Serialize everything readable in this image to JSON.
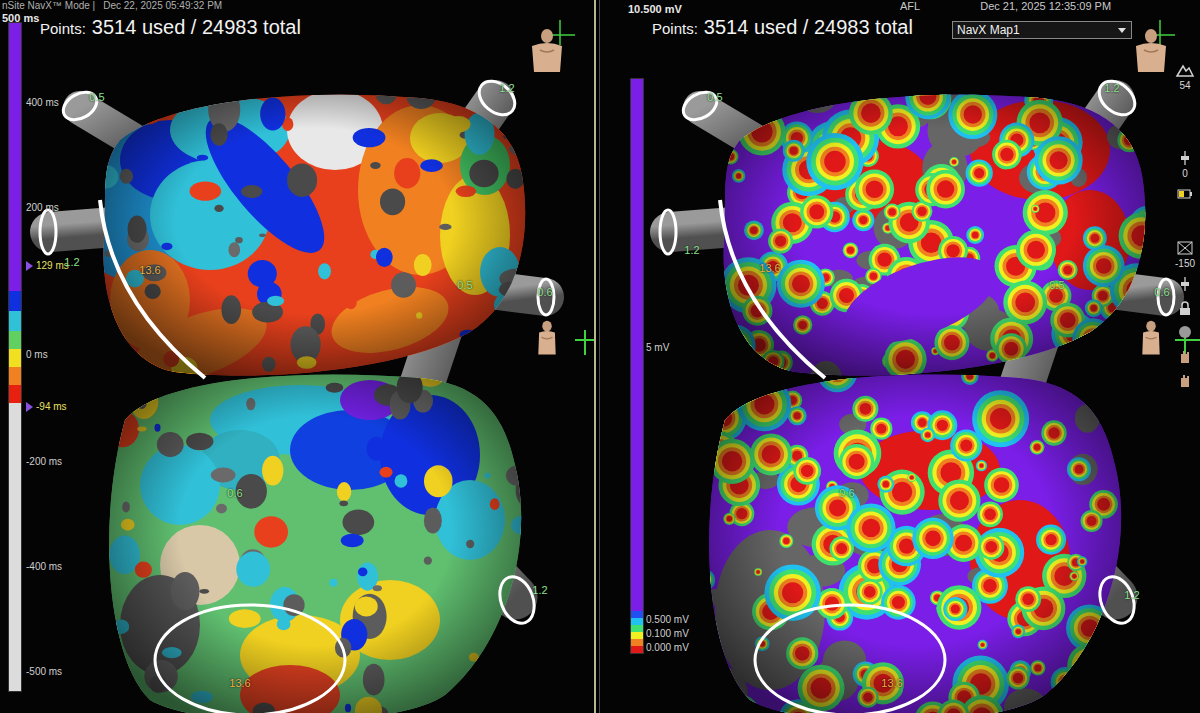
{
  "left_pane": {
    "header": {
      "mode": "nSite NavX™ Mode |",
      "date": "Dec 22, 2025 05:49:32 PM"
    },
    "points": {
      "label": "Points:",
      "value": "3514 used / 24983 total"
    },
    "scale": {
      "max": "500 ms",
      "ticks": [
        {
          "text": "400 ms",
          "kind": "tick"
        },
        {
          "text": "200 ms",
          "kind": "tick"
        },
        {
          "text": "129 ms",
          "kind": "marker"
        },
        {
          "text": "0 ms",
          "kind": "tick"
        },
        {
          "text": "-94 ms",
          "kind": "marker"
        },
        {
          "text": "-200 ms",
          "kind": "tick"
        },
        {
          "text": "-400 ms",
          "kind": "tick"
        },
        {
          "text": "-500 ms",
          "kind": "tick"
        }
      ]
    },
    "views": [
      {
        "labels": [
          "0.5",
          "1.2",
          "1.2",
          "13.6",
          "0.6"
        ]
      },
      {
        "labels": [
          "0.6",
          "0.5",
          "1.2",
          "13.6"
        ]
      }
    ]
  },
  "right_pane": {
    "header": {
      "title": "AFL",
      "date": "Dec 21, 2025 12:35:09 PM"
    },
    "map_select": {
      "value": "NavX Map1"
    },
    "points": {
      "label": "Points:",
      "value": "3514 used / 24983 total"
    },
    "scale": {
      "max": "10.500 mV",
      "ticks": [
        {
          "text": "5 mV",
          "kind": "tick"
        },
        {
          "text": "0.500 mV",
          "kind": "tick"
        },
        {
          "text": "0.100 mV",
          "kind": "tick"
        },
        {
          "text": "0.000 mV",
          "kind": "tick"
        }
      ]
    },
    "views": [
      {
        "labels": [
          "0.5",
          "1.2",
          "1.2",
          "13.6",
          "0.6"
        ]
      },
      {
        "labels": [
          "0.6",
          "0.5",
          "1.2",
          "13.6"
        ]
      }
    ],
    "toolbar": [
      "54",
      "0",
      "-150"
    ]
  }
}
